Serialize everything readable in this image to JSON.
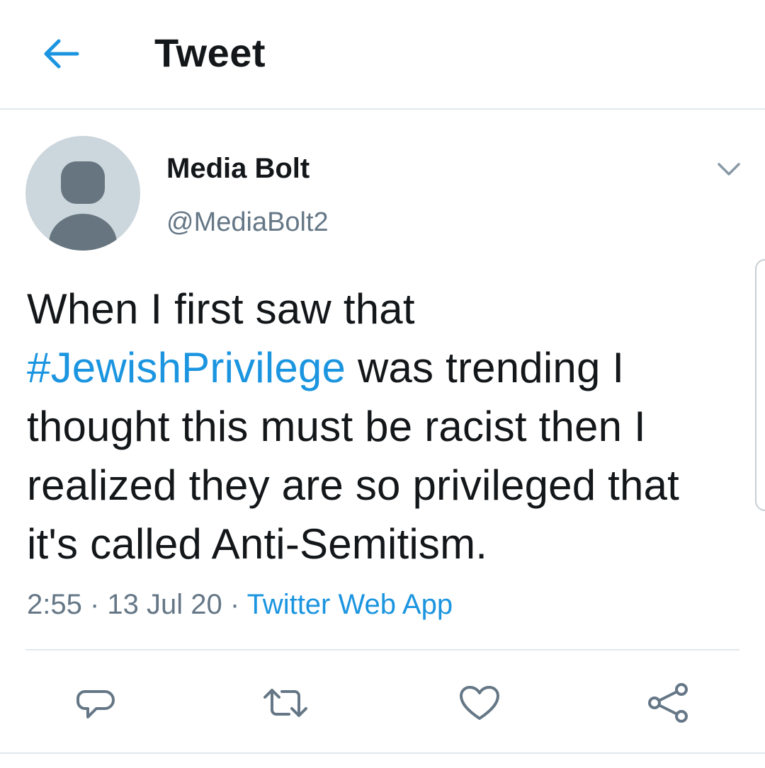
{
  "header": {
    "title": "Tweet",
    "back_icon": "arrow-left-icon"
  },
  "author": {
    "name": "Media Bolt",
    "handle": "@MediaBolt2",
    "avatar_icon": "default-avatar-icon"
  },
  "tweet": {
    "text_before_hashtag": "When I first saw that ",
    "hashtag": "#JewishPrivilege",
    "text_after_hashtag": " was trending I thought this must be racist then I realized they are so privileged that it's called Anti-Semitism."
  },
  "meta": {
    "time": "2:55",
    "separator": " · ",
    "date": "13 Jul 20",
    "source": "Twitter Web App"
  },
  "actions": [
    {
      "icon": "reply-icon"
    },
    {
      "icon": "retweet-icon"
    },
    {
      "icon": "like-icon"
    },
    {
      "icon": "share-icon"
    }
  ],
  "colors": {
    "accent": "#1b95e0",
    "text_primary": "#14171a",
    "text_secondary": "#657786",
    "border": "#e1e8ed",
    "avatar_bg": "#ccd6dd",
    "avatar_fg": "#66757f"
  }
}
